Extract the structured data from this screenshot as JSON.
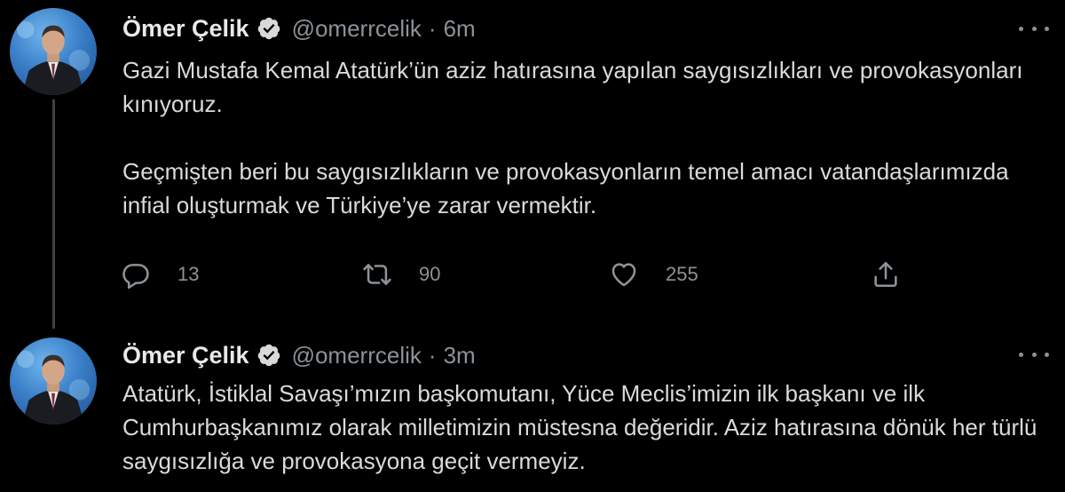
{
  "colors": {
    "background": "#000000",
    "text": "#dadada",
    "muted": "#8b9298",
    "verified_badge": "#d9d9d9",
    "thread_line": "#3d4249"
  },
  "tweets": [
    {
      "author": {
        "name": "Ömer Çelik",
        "handle": "@omerrcelik",
        "verified_icon": "verified-badge-icon",
        "avatar": "avatar-photo"
      },
      "separator": "·",
      "time": "6m",
      "paragraphs": [
        "Gazi Mustafa Kemal Atatürk’ün aziz hatırasına yapılan saygısızlıkları ve provokasyonları kınıyoruz.",
        "Geçmişten beri bu saygısızlıkların ve provokasyonların  temel amacı vatandaşlarımızda infial oluşturmak ve Türkiye’ye zarar vermektir."
      ],
      "actions": {
        "reply": {
          "icon": "reply-icon",
          "count": "13"
        },
        "retweet": {
          "icon": "retweet-icon",
          "count": "90"
        },
        "like": {
          "icon": "heart-icon",
          "count": "255"
        },
        "share": {
          "icon": "share-icon"
        }
      },
      "more_icon": "more-dots-icon"
    },
    {
      "author": {
        "name": "Ömer Çelik",
        "handle": "@omerrcelik",
        "verified_icon": "verified-badge-icon",
        "avatar": "avatar-photo"
      },
      "separator": "·",
      "time": "3m",
      "paragraphs": [
        "Atatürk, İstiklal Savaşı’mızın başkomutanı, Yüce Meclis’imizin ilk başkanı ve ilk Cumhurbaşkanımız olarak milletimizin müstesna değeridir. Aziz hatırasına dönük her türlü saygısızlığa ve provokasyona geçit vermeyiz."
      ],
      "more_icon": "more-dots-icon"
    }
  ]
}
